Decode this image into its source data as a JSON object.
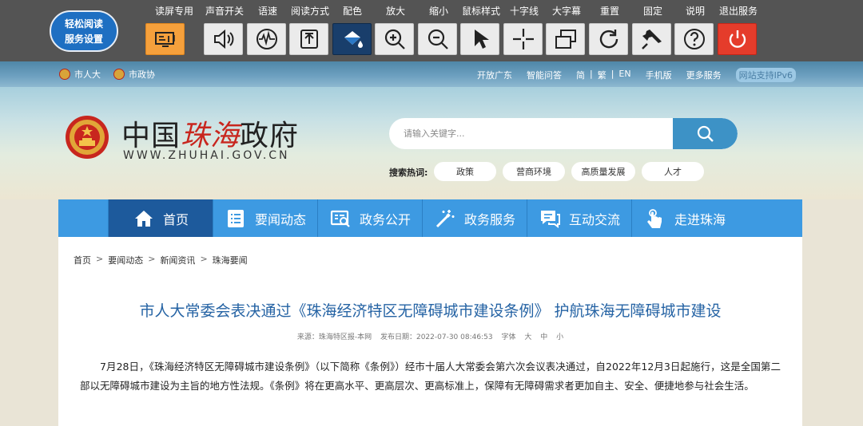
{
  "a11y": {
    "logo_line1": "轻松阅读",
    "logo_line2": "服务设置",
    "buttons": [
      {
        "label": "读屏专用",
        "icon": "screen-reader-icon"
      },
      {
        "label": "声音开关",
        "icon": "speaker-icon"
      },
      {
        "label": "语速",
        "icon": "speech-speed-icon"
      },
      {
        "label": "阅读方式",
        "icon": "reading-mode-icon"
      },
      {
        "label": "配色",
        "icon": "color-scheme-icon"
      },
      {
        "label": "放大",
        "icon": "zoom-in-icon"
      },
      {
        "label": "缩小",
        "icon": "zoom-out-icon"
      },
      {
        "label": "鼠标样式",
        "icon": "mouse-pointer-icon"
      },
      {
        "label": "十字线",
        "icon": "crosshair-icon"
      },
      {
        "label": "大字幕",
        "icon": "large-caption-icon"
      },
      {
        "label": "重置",
        "icon": "reset-icon"
      },
      {
        "label": "固定",
        "icon": "pin-icon"
      },
      {
        "label": "说明",
        "icon": "help-icon"
      },
      {
        "label": "退出服务",
        "icon": "power-icon"
      }
    ]
  },
  "top_links": {
    "left": [
      "市人大",
      "市政协"
    ],
    "open_guangdong": "开放广东",
    "smart_qa": "智能问答",
    "lang_simplified": "简",
    "lang_traditional": "繁",
    "lang_english": "EN",
    "mobile": "手机版",
    "more_services": "更多服务",
    "ipv6": "网站支持IPv6"
  },
  "header": {
    "title_a": "中国",
    "title_red": "珠海",
    "title_b": "政府",
    "url": "WWW.ZHUHAI.GOV.CN",
    "search_placeholder": "请输入关键字...",
    "hot_label": "搜索热词:",
    "hot_tags": [
      "政策",
      "营商环境",
      "高质量发展",
      "人才"
    ]
  },
  "nav": {
    "items": [
      "首页",
      "要闻动态",
      "政务公开",
      "政务服务",
      "互动交流",
      "走进珠海"
    ]
  },
  "breadcrumb": [
    "首页",
    "要闻动态",
    "新闻资讯",
    "珠海要闻"
  ],
  "article": {
    "title": "市人大常委会表决通过《珠海经济特区无障碍城市建设条例》 护航珠海无障碍城市建设",
    "source": "来源：珠海特区报-本网",
    "date": "发布日期：2022-07-30 08:46:53",
    "font_label": "字体",
    "font_large": "大",
    "font_medium": "中",
    "font_small": "小",
    "body": "7月28日，《珠海经济特区无障碍城市建设条例》（以下简称《条例》）经市十届人大常委会第六次会议表决通过，自2022年12月3日起施行，这是全国第二部以无障碍城市建设为主旨的地方性法规。《条例》将在更高水平、更高层次、更高标准上，保障有无障碍需求者更加自主、安全、便捷地参与社会生活。"
  },
  "colors": {
    "toolbar_bg": "#545454",
    "nav_bg": "#3d9ae2",
    "nav_active": "#1d5a9c",
    "title_blue": "#2563a4",
    "search_btn": "#3d92c6"
  }
}
